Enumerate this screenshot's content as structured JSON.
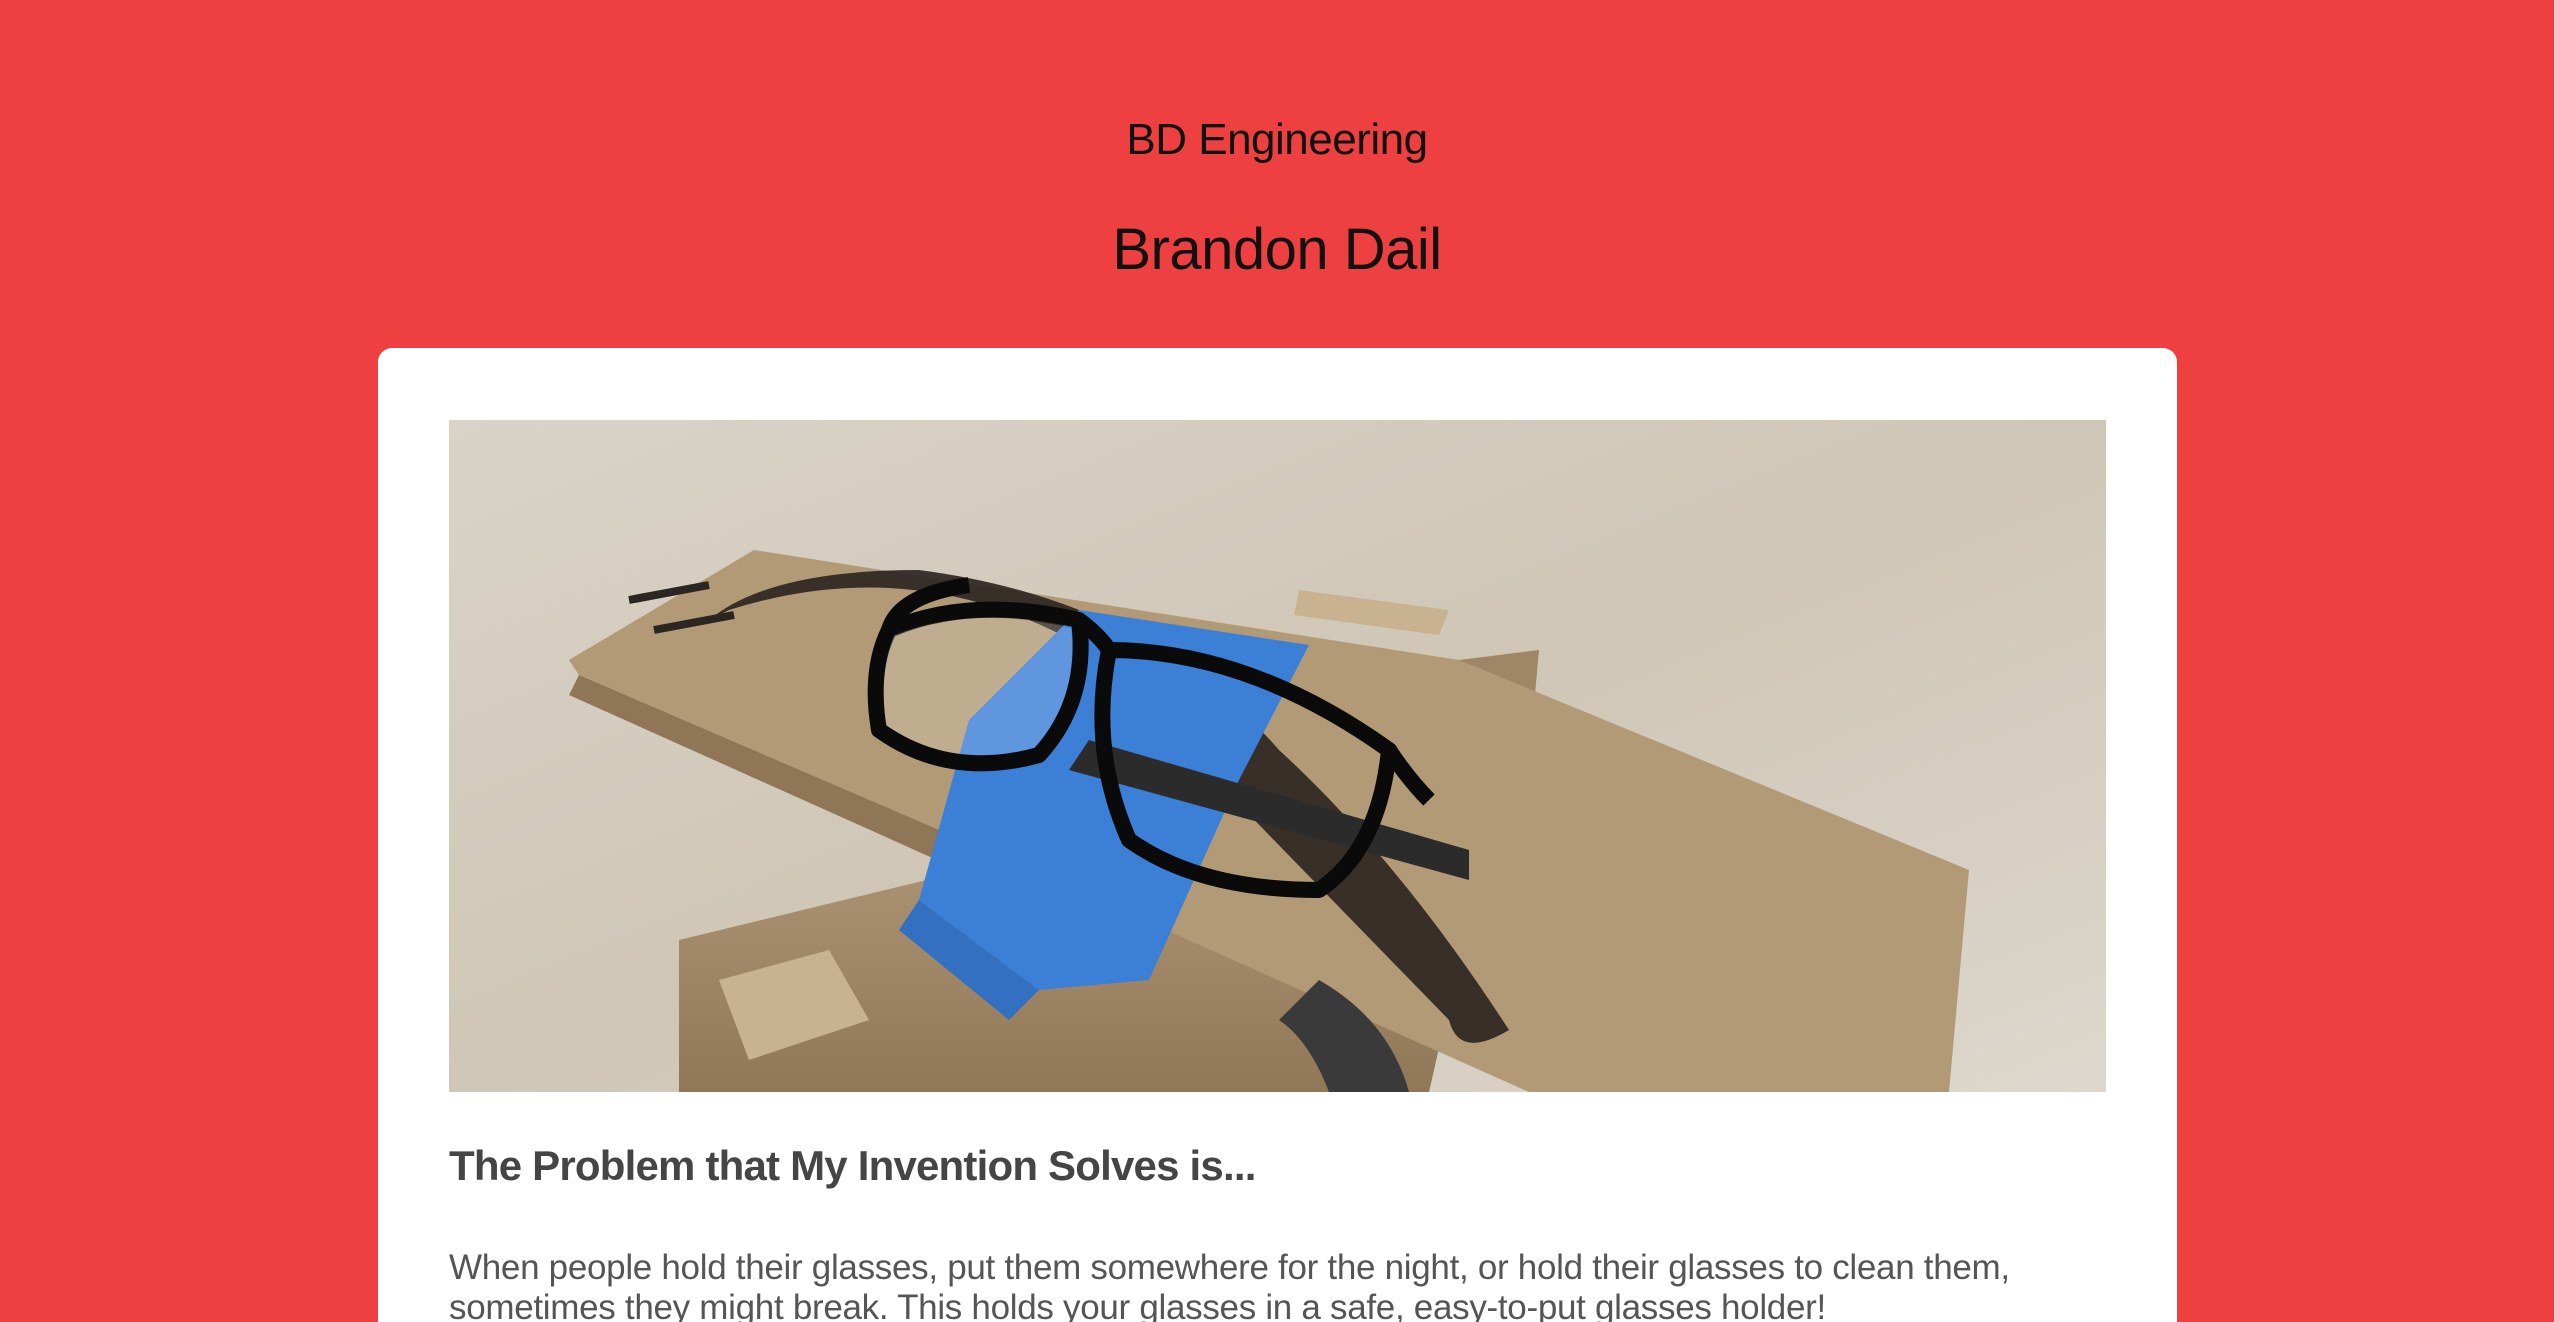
{
  "header": {
    "site_name": "BD Engineering",
    "author_name": "Brandon Dail"
  },
  "hero_image": {
    "alt": "Eyeglasses resting on a cardboard glasses holder"
  },
  "article": {
    "heading": "The Problem that My Invention Solves is...",
    "body": "When people hold their glasses, put them somewhere for the night, or hold their glasses to clean them, sometimes they might break. This holds your glasses in a safe, easy-to-put glasses holder!"
  },
  "colors": {
    "page_background": "#ee4040",
    "card_background": "#ffffff"
  }
}
